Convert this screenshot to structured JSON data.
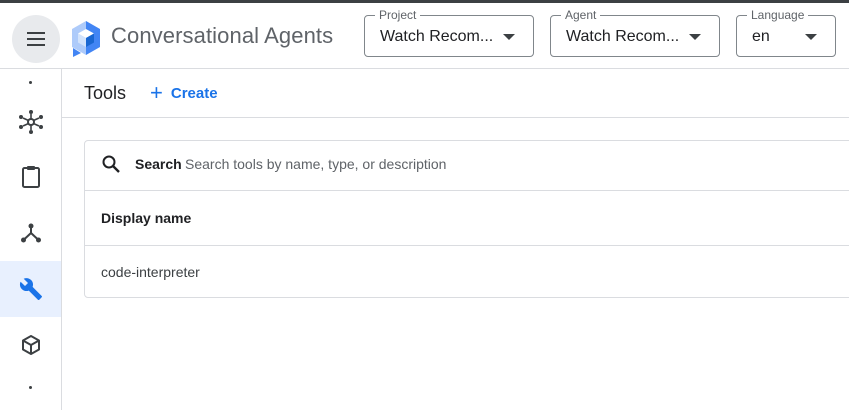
{
  "app": {
    "title": "Conversational Agents"
  },
  "selectors": {
    "project": {
      "label": "Project",
      "value": "Watch Recom..."
    },
    "agent": {
      "label": "Agent",
      "value": "Watch Recom..."
    },
    "language": {
      "label": "Language",
      "value": "en"
    }
  },
  "sidebar": {
    "items": [
      {
        "icon": "hub-icon"
      },
      {
        "icon": "clipboard-icon"
      },
      {
        "icon": "flow-icon"
      },
      {
        "icon": "wrench-icon"
      },
      {
        "icon": "cube-icon"
      }
    ]
  },
  "page": {
    "title": "Tools",
    "create_label": "Create"
  },
  "search": {
    "label": "Search",
    "placeholder": "Search tools by name, type, or description"
  },
  "table": {
    "columns": [
      "Display name"
    ],
    "rows": [
      {
        "display_name": "code-interpreter"
      }
    ]
  },
  "colors": {
    "accent": "#1a73e8",
    "active_nav_bg": "#e8f0fe",
    "border": "#dadce0"
  }
}
